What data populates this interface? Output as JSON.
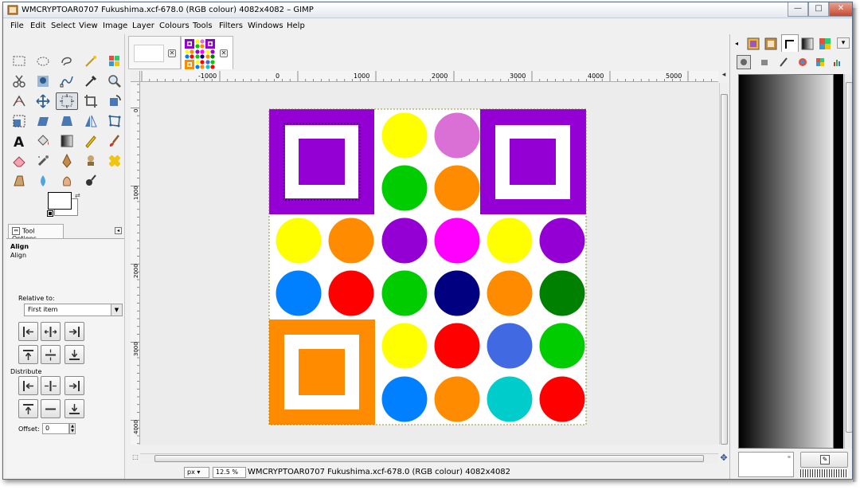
{
  "window": {
    "title": "WMCRYPTOAR0707 Fukushima.xcf-678.0 (RGB colour) 4082x4082 – GIMP",
    "minimize": "—",
    "maximize": "□",
    "close": "✕"
  },
  "menubar": [
    "File",
    "Edit",
    "Select",
    "View",
    "Image",
    "Layer",
    "Colours",
    "Tools",
    "Filters",
    "Windows",
    "Help"
  ],
  "toolbox": {
    "tools": [
      "rect-select-icon",
      "ellipse-select-icon",
      "free-select-icon",
      "fuzzy-select-icon",
      "by-colour-select-icon",
      "scissors-select-icon",
      "foreground-select-icon",
      "paths-icon",
      "colour-picker-icon",
      "zoom-icon",
      "measure-icon",
      "move-icon",
      "align-icon",
      "crop-icon",
      "rotate-icon",
      "scale-icon",
      "shear-icon",
      "perspective-icon",
      "flip-icon",
      "cage-icon",
      "text-icon",
      "bucket-fill-icon",
      "blend-icon",
      "pencil-icon",
      "paintbrush-icon",
      "eraser-icon",
      "airbrush-icon",
      "ink-icon",
      "clone-icon",
      "heal-icon",
      "perspective-clone-icon",
      "blur-icon",
      "smudge-icon",
      "dodge-burn-icon"
    ],
    "active_tool": "align-icon"
  },
  "tool_options": {
    "tab_label": "Tool Options",
    "heading": "Align",
    "subheading": "Align",
    "relative_to_label": "Relative to:",
    "relative_to_value": "First item",
    "distribute_label": "Distribute",
    "offset_label": "Offset:",
    "offset_value": "0"
  },
  "image_tabs": [
    {
      "name": "blank-image-tab"
    },
    {
      "name": "fukushima-image-tab",
      "active": true
    }
  ],
  "rulers": {
    "h_labels": [
      "-1000",
      "0",
      "1000",
      "2000",
      "3000",
      "4000",
      "5000"
    ],
    "v_labels": [
      "0",
      "1000",
      "2000",
      "3000",
      "4000"
    ]
  },
  "status": {
    "unit": "px",
    "zoom": "12.5 %",
    "message": "WMCRYPTOAR0707 Fukushima.xcf-678.0 (RGB colour) 4082x4082"
  },
  "artwork": {
    "purple": "#9400d3",
    "orange": "#ff8c00",
    "circles": [
      [
        "#ffff00",
        "#da70d6"
      ],
      [
        "#00cc00",
        "#ff8c00"
      ],
      [
        "#ffff00",
        "#ff8c00",
        "#9400d3",
        "#ff00ff",
        "#ffff00",
        "#9400d3"
      ],
      [
        "#0080ff",
        "#ff0000",
        "#00cc00",
        "#000080",
        "#ff8c00",
        "#008000"
      ],
      [
        "#ffff00",
        "#ff0000",
        "#4169e1",
        "#00cc00"
      ],
      [
        "#0080ff",
        "#ff8c00",
        "#00cccc",
        "#ff0000"
      ]
    ]
  },
  "dock": {
    "tabs": [
      "brushes-icon",
      "patterns-icon",
      "fonts-icon",
      "gradients-icon",
      "palettes-icon"
    ],
    "subtabs": [
      "tool-options-icon",
      "device-status-icon",
      "paint-dynamics-icon",
      "colours-icon",
      "palette-editor-icon",
      "histogram-icon"
    ]
  }
}
